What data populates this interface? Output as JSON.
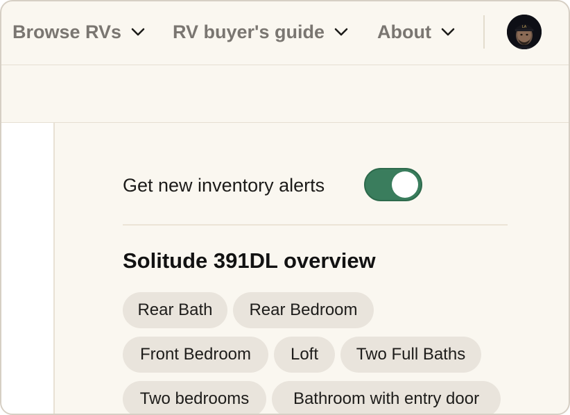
{
  "nav": {
    "items": [
      {
        "label": "Browse RVs"
      },
      {
        "label": "RV buyer's guide"
      },
      {
        "label": "About"
      }
    ]
  },
  "alerts": {
    "label": "Get new inventory alerts",
    "enabled": true
  },
  "overview": {
    "title": "Solitude 391DL overview",
    "tags": [
      "Rear Bath",
      "Rear Bedroom",
      "Front Bedroom",
      "Loft",
      "Two Full Baths",
      "Two bedrooms",
      "Bathroom with entry door"
    ]
  },
  "colors": {
    "toggle_on": "#3a7d5d",
    "nav_text": "#7a7671",
    "chip_bg": "#e9e4dc",
    "page_bg": "#faf7f0"
  }
}
